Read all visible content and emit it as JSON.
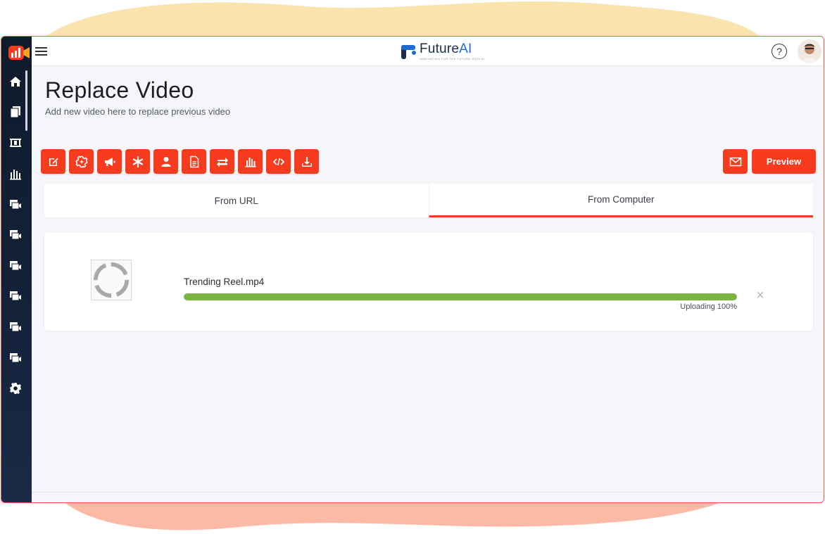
{
  "brand": {
    "name": "FutureAI",
    "name_prefix": "Future",
    "name_suffix": "AI",
    "tagline": "INNOVATING FOR THE FUTURE WITH AI"
  },
  "page": {
    "title": "Replace Video",
    "subtitle": "Add new video here to replace previous video"
  },
  "topbar": {
    "help_symbol": "?"
  },
  "sidebar": {
    "items": [
      {
        "icon": "home-icon"
      },
      {
        "icon": "documents-icon"
      },
      {
        "icon": "film-icon"
      },
      {
        "icon": "bar-chart-icon"
      },
      {
        "icon": "video-gallery-icon"
      },
      {
        "icon": "video-gallery-icon"
      },
      {
        "icon": "video-gallery-icon"
      },
      {
        "icon": "video-gallery-icon"
      },
      {
        "icon": "video-gallery-icon"
      },
      {
        "icon": "video-gallery-icon"
      },
      {
        "icon": "gear-icon"
      }
    ]
  },
  "toolbar": {
    "tools": [
      {
        "icon": "edit-icon"
      },
      {
        "icon": "settings-sparkle-icon"
      },
      {
        "icon": "megaphone-icon"
      },
      {
        "icon": "asterisk-icon"
      },
      {
        "icon": "user-icon"
      },
      {
        "icon": "document-icon"
      },
      {
        "icon": "swap-arrows-icon"
      },
      {
        "icon": "bar-chart-icon"
      },
      {
        "icon": "code-icon"
      },
      {
        "icon": "download-icon"
      }
    ],
    "mail_icon": "mail-icon",
    "preview_label": "Preview"
  },
  "tabs": [
    {
      "label": "From URL",
      "active": false
    },
    {
      "label": "From Computer",
      "active": true
    }
  ],
  "upload": {
    "file_name": "Trending Reel.mp4",
    "progress": 100,
    "status_text": "Uploading 100%",
    "progress_color": "#7cb442",
    "cancel_symbol": "×"
  },
  "colors": {
    "accent": "#f73b1e",
    "sidebar_bg": "#0f1a2b"
  }
}
